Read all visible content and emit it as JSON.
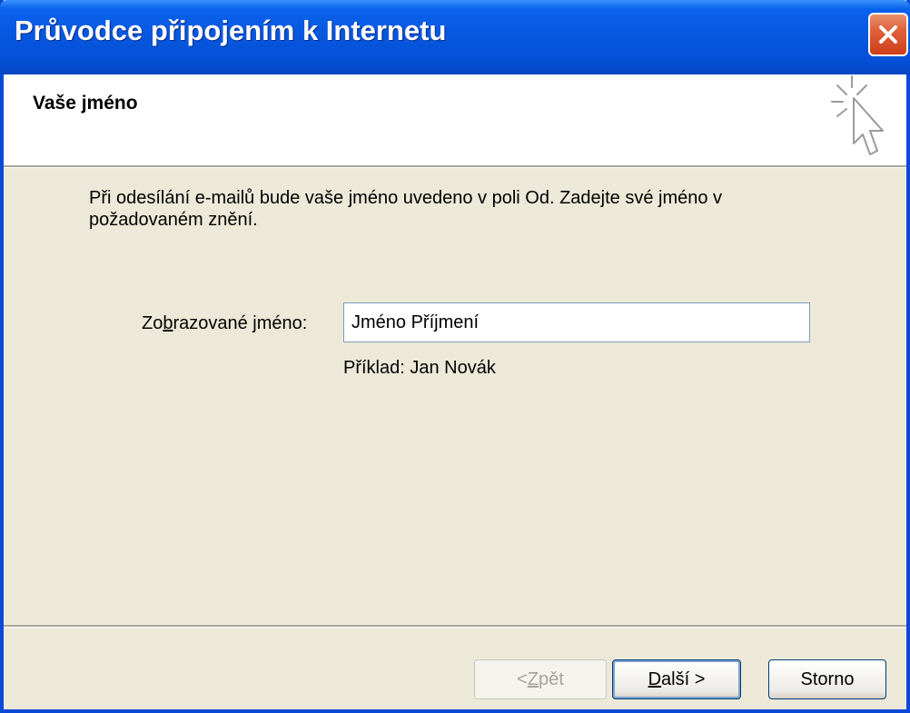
{
  "window": {
    "title": "Průvodce připojením k Internetu",
    "close_icon": "close-icon"
  },
  "header": {
    "title": "Vaše jméno",
    "icon": "wizard-cursor-icon"
  },
  "body": {
    "description": "Při odesílání e-mailů bude vaše jméno uvedeno v poli Od. Zadejte své jméno v požadovaném znění."
  },
  "form": {
    "label_before": "Zo",
    "label_accel": "b",
    "label_after": "razované jméno:",
    "value": "Jméno Příjmení",
    "example": "Příklad: Jan Novák"
  },
  "buttons": {
    "back_before": "< ",
    "back_accel": "Z",
    "back_after": "pět",
    "next_accel": "D",
    "next_after": "alší >",
    "cancel": "Storno"
  },
  "colors": {
    "titlebar": "#0858e0",
    "dialog_bg": "#ece9d8",
    "close_button": "#e0603a"
  }
}
